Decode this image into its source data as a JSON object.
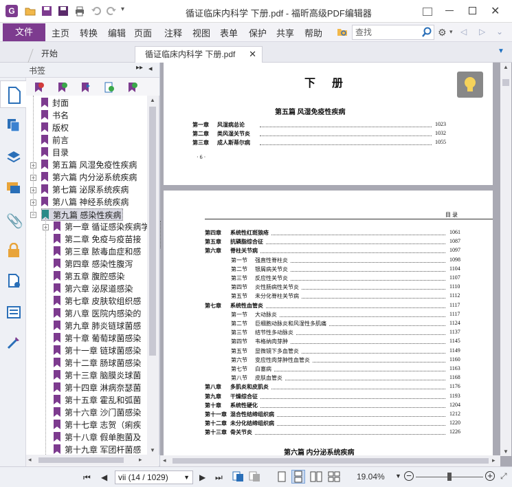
{
  "app": {
    "title": "循证临床内科学 下册.pdf - 福昕高级PDF编辑器",
    "accent": "#7d3b8f"
  },
  "menubar": {
    "file": "文件",
    "items": [
      "主页",
      "转换",
      "编辑",
      "页面",
      "注释",
      "视图",
      "表单",
      "保护",
      "共享",
      "帮助"
    ],
    "search_placeholder": "查找"
  },
  "tabs": {
    "start": "开始",
    "doc": "循证临床内科学 下册.pdf"
  },
  "bookmarks": {
    "title": "书签",
    "items": [
      {
        "level": 1,
        "label": "封面",
        "exp": ""
      },
      {
        "level": 1,
        "label": "书名",
        "exp": ""
      },
      {
        "level": 1,
        "label": "版权",
        "exp": ""
      },
      {
        "level": 1,
        "label": "前言",
        "exp": ""
      },
      {
        "level": 1,
        "label": "目录",
        "exp": ""
      },
      {
        "level": 1,
        "label": "第五篇 风湿免疫性疾病",
        "exp": "+"
      },
      {
        "level": 1,
        "label": "第六篇 内分泌系统疾病",
        "exp": "+"
      },
      {
        "level": 1,
        "label": "第七篇 泌尿系统疾病",
        "exp": "+"
      },
      {
        "level": 1,
        "label": "第八篇 神经系统疾病",
        "exp": "+"
      },
      {
        "level": 1,
        "label": "第九篇 感染性疾病",
        "exp": "-",
        "selected": true
      },
      {
        "level": 2,
        "label": "第一章 循证感染疾病学",
        "exp": "+"
      },
      {
        "level": 2,
        "label": "第二章 免疫与疫苗接",
        "exp": ""
      },
      {
        "level": 2,
        "label": "第三章 脓毒血症和感",
        "exp": ""
      },
      {
        "level": 2,
        "label": "第四章 感染性腹泻",
        "exp": ""
      },
      {
        "level": 2,
        "label": "第五章 腹腔感染",
        "exp": ""
      },
      {
        "level": 2,
        "label": "第六章 泌尿道感染",
        "exp": ""
      },
      {
        "level": 2,
        "label": "第七章 皮肤软组织感",
        "exp": ""
      },
      {
        "level": 2,
        "label": "第八章 医院内感染的",
        "exp": ""
      },
      {
        "level": 2,
        "label": "第九章 肺炎链球菌感",
        "exp": ""
      },
      {
        "level": 2,
        "label": "第十章 葡萄球菌感染",
        "exp": ""
      },
      {
        "level": 2,
        "label": "第十一章 链球菌感染",
        "exp": ""
      },
      {
        "level": 2,
        "label": "第十二章 肠球菌感染",
        "exp": ""
      },
      {
        "level": 2,
        "label": "第十三章 脑膜炎球菌",
        "exp": ""
      },
      {
        "level": 2,
        "label": "第十四章 淋病奈瑟菌",
        "exp": ""
      },
      {
        "level": 2,
        "label": "第十五章 霍乱和弧菌",
        "exp": ""
      },
      {
        "level": 2,
        "label": "第十六章 沙门菌感染",
        "exp": ""
      },
      {
        "level": 2,
        "label": "第十七章 志贺（痢疾",
        "exp": ""
      },
      {
        "level": 2,
        "label": "第十八章 假单胞菌及",
        "exp": ""
      },
      {
        "level": 2,
        "label": "第十九章 军团杆菌感",
        "exp": ""
      }
    ]
  },
  "page1": {
    "heading": "下 册",
    "part": "第五篇   风湿免疫性疾病",
    "entries": [
      {
        "ch": "第一章",
        "title": "风湿病总论",
        "page": "1023"
      },
      {
        "ch": "第二章",
        "title": "类风湿关节炎",
        "page": "1032"
      },
      {
        "ch": "第三章",
        "title": "成人斯蒂尔病",
        "page": "1055"
      }
    ],
    "page_no": "· 6 ·"
  },
  "page2": {
    "running_head": "目    录",
    "entries": [
      {
        "ch": "第四章",
        "title": "系统性红斑狼疮",
        "page": "1061",
        "sub": false
      },
      {
        "ch": "第五章",
        "title": "抗磷脂综合征",
        "page": "1087",
        "sub": false
      },
      {
        "ch": "第六章",
        "title": "脊柱关节病",
        "page": "1097",
        "sub": false
      },
      {
        "ch": "第一节",
        "title": "强直性脊柱炎",
        "page": "1098",
        "sub": true
      },
      {
        "ch": "第二节",
        "title": "银屑病关节炎",
        "page": "1104",
        "sub": true
      },
      {
        "ch": "第三节",
        "title": "反应性关节炎",
        "page": "1107",
        "sub": true
      },
      {
        "ch": "第四节",
        "title": "炎性肠病性关节炎",
        "page": "1110",
        "sub": true
      },
      {
        "ch": "第五节",
        "title": "未分化脊柱关节病",
        "page": "1112",
        "sub": true
      },
      {
        "ch": "第七章",
        "title": "系统性血管炎",
        "page": "1117",
        "sub": false
      },
      {
        "ch": "第一节",
        "title": "大动脉炎",
        "page": "1117",
        "sub": true
      },
      {
        "ch": "第二节",
        "title": "巨细胞动脉炎和风湿性多肌痛",
        "page": "1124",
        "sub": true
      },
      {
        "ch": "第三节",
        "title": "结节性多动脉炎",
        "page": "1137",
        "sub": true
      },
      {
        "ch": "第四节",
        "title": "韦格纳肉芽肿",
        "page": "1145",
        "sub": true
      },
      {
        "ch": "第五节",
        "title": "显微镜下多血管炎",
        "page": "1149",
        "sub": true
      },
      {
        "ch": "第六节",
        "title": "变应性肉芽肿性血管炎",
        "page": "1160",
        "sub": true
      },
      {
        "ch": "第七节",
        "title": "白塞病",
        "page": "1163",
        "sub": true
      },
      {
        "ch": "第八节",
        "title": "皮肤血管炎",
        "page": "1168",
        "sub": true
      },
      {
        "ch": "第八章",
        "title": "多肌炎和皮肌炎",
        "page": "1176",
        "sub": false
      },
      {
        "ch": "第九章",
        "title": "干燥综合征",
        "page": "1193",
        "sub": false
      },
      {
        "ch": "第十章",
        "title": "系统性硬化",
        "page": "1204",
        "sub": false
      },
      {
        "ch": "第十一章",
        "title": "混合性结缔组织病",
        "page": "1212",
        "sub": false
      },
      {
        "ch": "第十二章",
        "title": "未分化结缔组织病",
        "page": "1220",
        "sub": false
      },
      {
        "ch": "第十三章",
        "title": "骨关节炎",
        "page": "1226",
        "sub": false
      }
    ],
    "next_part": "第六篇   内分泌系统疾病"
  },
  "status": {
    "page_select": "vii (14 / 1029)",
    "zoom": "19.04%"
  }
}
